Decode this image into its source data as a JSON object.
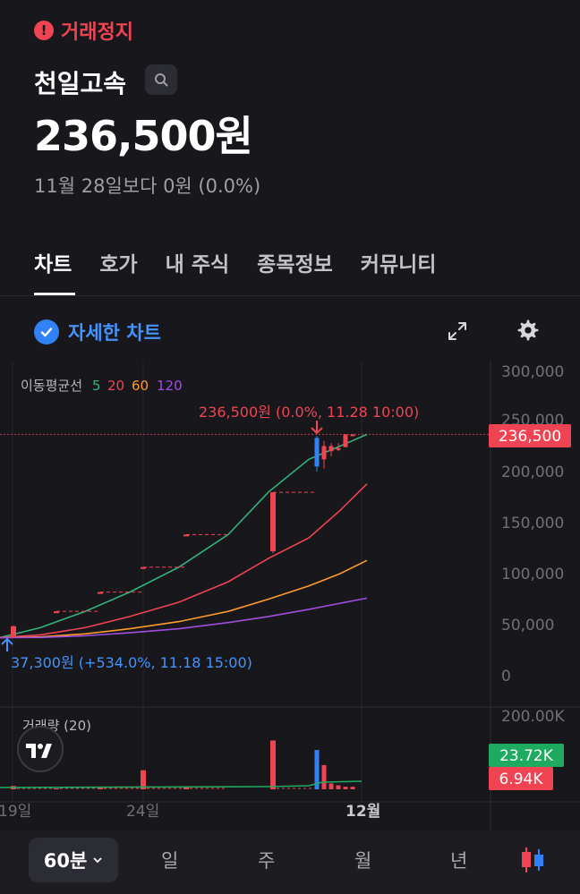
{
  "status": {
    "text": "거래정지",
    "icon": "exclamation-icon",
    "color": "#f04452"
  },
  "stock": {
    "name": "천일고속",
    "price": "236,500원",
    "change": "11월 28일보다 0원 (0.0%)"
  },
  "tabs": [
    {
      "label": "차트",
      "active": true
    },
    {
      "label": "호가",
      "active": false
    },
    {
      "label": "내 주식",
      "active": false
    },
    {
      "label": "종목정보",
      "active": false
    },
    {
      "label": "커뮤니티",
      "active": false
    }
  ],
  "chart_toolbar": {
    "detail_label": "자세한 차트",
    "detail_checked": true
  },
  "chart": {
    "ma_title": "이동평균선",
    "ma_labels": [
      {
        "label": "5",
        "color": "#33b37a"
      },
      {
        "label": "20",
        "color": "#f04452"
      },
      {
        "label": "60",
        "color": "#ff9a2e"
      },
      {
        "label": "120",
        "color": "#a04ee0"
      }
    ],
    "y_ticks": [
      "300,000",
      "250,000",
      "200,000",
      "150,000",
      "100,000",
      "50,000",
      "0"
    ],
    "current_price_tag": "236,500",
    "high_annotation": "236,500원 (0.0%, 11.28 10:00)",
    "low_annotation": "37,300원 (+534.0%, 11.18 15:00)",
    "volume_title": "거래량 (20)",
    "volume_max_tick": "200.00K",
    "volume_tag_ma": "23.72K",
    "volume_tag_last": "6.94K",
    "x_ticks": [
      "19일",
      "24일",
      "12월"
    ],
    "colors": {
      "up": "#f04452",
      "down": "#3182f6",
      "price_line": "#f04452",
      "ma_volume": "#1fab5f"
    }
  },
  "chart_data": {
    "type": "candlestick",
    "ylim": [
      0,
      300000
    ],
    "volume_ylim": [
      0,
      200000
    ],
    "candles": [
      {
        "open": 37300,
        "high": 49000,
        "low": 37300,
        "close": 48500,
        "volume": 9000
      },
      {
        "open": 63000,
        "high": 63000,
        "low": 63000,
        "close": 63000,
        "volume": 2500
      },
      {
        "open": 81900,
        "high": 81900,
        "low": 81900,
        "close": 81900,
        "volume": 4000
      },
      {
        "open": 106400,
        "high": 106400,
        "low": 106400,
        "close": 106400,
        "volume": 52000
      },
      {
        "open": 138300,
        "high": 138300,
        "low": 138300,
        "close": 138300,
        "volume": 6000
      },
      {
        "open": 122000,
        "high": 179700,
        "low": 120000,
        "close": 179700,
        "volume": 133000
      },
      {
        "open": 233000,
        "high": 235000,
        "low": 200000,
        "close": 205000,
        "volume": 107000
      },
      {
        "open": 212000,
        "high": 230000,
        "low": 203000,
        "close": 225000,
        "volume": 66000
      },
      {
        "open": 220000,
        "high": 228000,
        "low": 215000,
        "close": 225000,
        "volume": 16000
      },
      {
        "open": 222000,
        "high": 228000,
        "low": 220000,
        "close": 223000,
        "volume": 11000
      },
      {
        "open": 224000,
        "high": 236500,
        "low": 224000,
        "close": 236500,
        "volume": 7000
      },
      {
        "open": 236500,
        "high": 236500,
        "low": 236500,
        "close": 236500,
        "volume": 6940
      }
    ],
    "moving_averages": [
      {
        "name": "5",
        "values": [
          37300,
          47000,
          63000,
          81900,
          106400,
          138300,
          180000,
          212000,
          225000,
          236500
        ]
      },
      {
        "name": "20",
        "values": [
          37300,
          40000,
          47000,
          58000,
          72000,
          92000,
          115000,
          135000,
          162000,
          188000
        ]
      },
      {
        "name": "60",
        "values": [
          37300,
          38000,
          41000,
          46000,
          53000,
          63000,
          75000,
          88000,
          100000,
          113000
        ]
      },
      {
        "name": "120",
        "values": [
          37300,
          37500,
          39000,
          42000,
          46000,
          52000,
          58000,
          65000,
          71000,
          76000
        ]
      }
    ],
    "volume_ma": 23720
  },
  "periods": [
    {
      "label": "60분",
      "active": true
    },
    {
      "label": "일",
      "active": false
    },
    {
      "label": "주",
      "active": false
    },
    {
      "label": "월",
      "active": false
    },
    {
      "label": "년",
      "active": false
    }
  ]
}
